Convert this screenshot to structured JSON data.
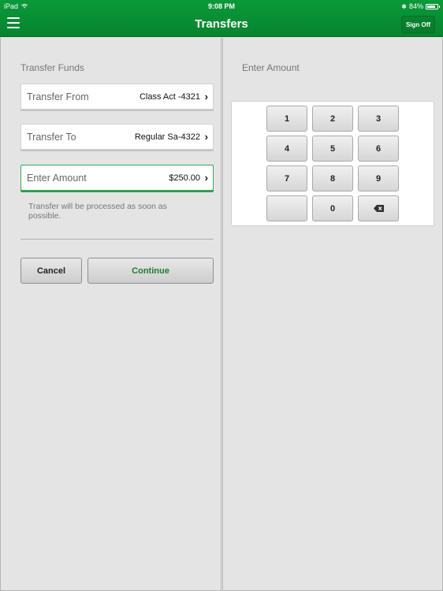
{
  "status_bar": {
    "device": "iPad",
    "time": "9:08 PM",
    "battery": "84%",
    "battery_level": 0.84
  },
  "header": {
    "title": "Transfers",
    "sign_off_label": "Sign Off"
  },
  "left_panel": {
    "section_title": "Transfer Funds",
    "fields": [
      {
        "label": "Transfer From",
        "value": "Class Act -4321"
      },
      {
        "label": "Transfer To",
        "value": "Regular Sa-4322"
      },
      {
        "label": "Enter Amount",
        "value": "$250.00"
      }
    ],
    "note": "Transfer will be processed as soon as possible.",
    "cancel_label": "Cancel",
    "continue_label": "Continue"
  },
  "right_panel": {
    "section_title": "Enter Amount",
    "keys": [
      "1",
      "2",
      "3",
      "4",
      "5",
      "6",
      "7",
      "8",
      "9",
      "",
      "0",
      "backspace"
    ]
  },
  "colors": {
    "accent_green": "#07842e",
    "continue_text": "#1c7d32",
    "active_field_border": "#3aa757"
  }
}
